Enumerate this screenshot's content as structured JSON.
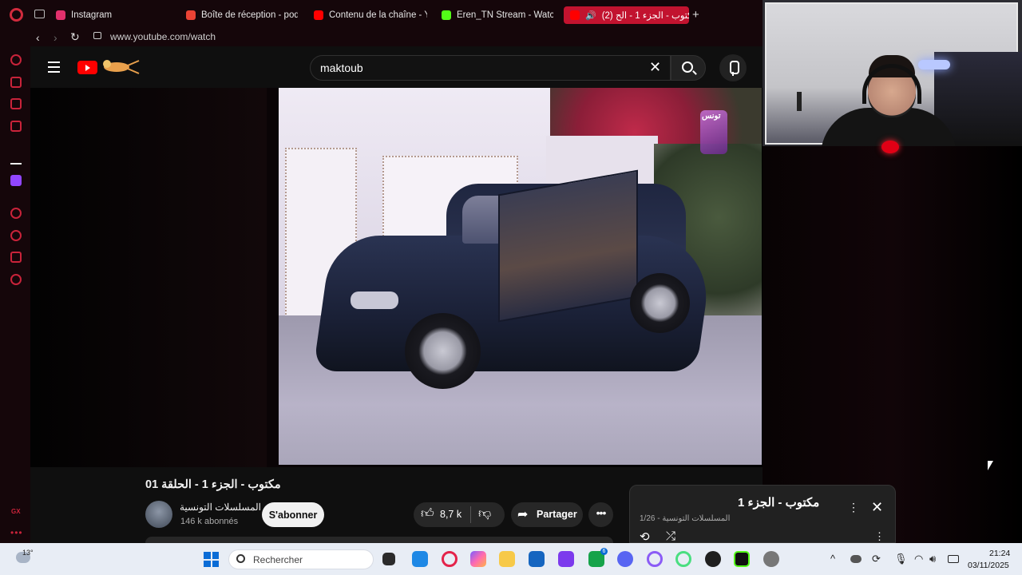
{
  "browser": {
    "tabs": [
      {
        "label": "Instagram",
        "icon": "instagram-icon",
        "color": "#e1306c"
      },
      {
        "label": "Boîte de réception - podc",
        "icon": "gmail-icon",
        "color": "#ea4335"
      },
      {
        "label": "Contenu de la chaîne - Yo",
        "icon": "youtube-icon",
        "color": "#ff0000"
      },
      {
        "label": "Eren_TN Stream - Watch L",
        "icon": "kick-icon",
        "color": "#53fc18"
      },
      {
        "label": "(2) مكتوب - الجزء 1 - الح",
        "icon": "youtube-icon",
        "color": "#ff0000",
        "active": true
      }
    ],
    "new_tab": "+",
    "url": "www.youtube.com/watch",
    "accent": "#c2132f"
  },
  "sidebar": {
    "gx_label": "GX",
    "more": "•••"
  },
  "youtube": {
    "search_value": "maktoub",
    "video": {
      "title": "مكتوب - الجزء 1 - الحلقة 01",
      "channel": "المسلسلات التونسية",
      "subscribers": "146 k abonnés",
      "subscribe_label": "S'abonner",
      "likes": "8,7 k",
      "share_label": "Partager",
      "more": "•••",
      "overlay_logo": "تونس"
    },
    "playlist": {
      "title": "مكتوب - الجزء 1",
      "meta": "المسلسلات التونسية - 1/26"
    }
  },
  "taskbar": {
    "temperature": "13°",
    "search_placeholder": "Rechercher",
    "badge": "6",
    "time": "21:24",
    "date": "03/11/2025"
  }
}
